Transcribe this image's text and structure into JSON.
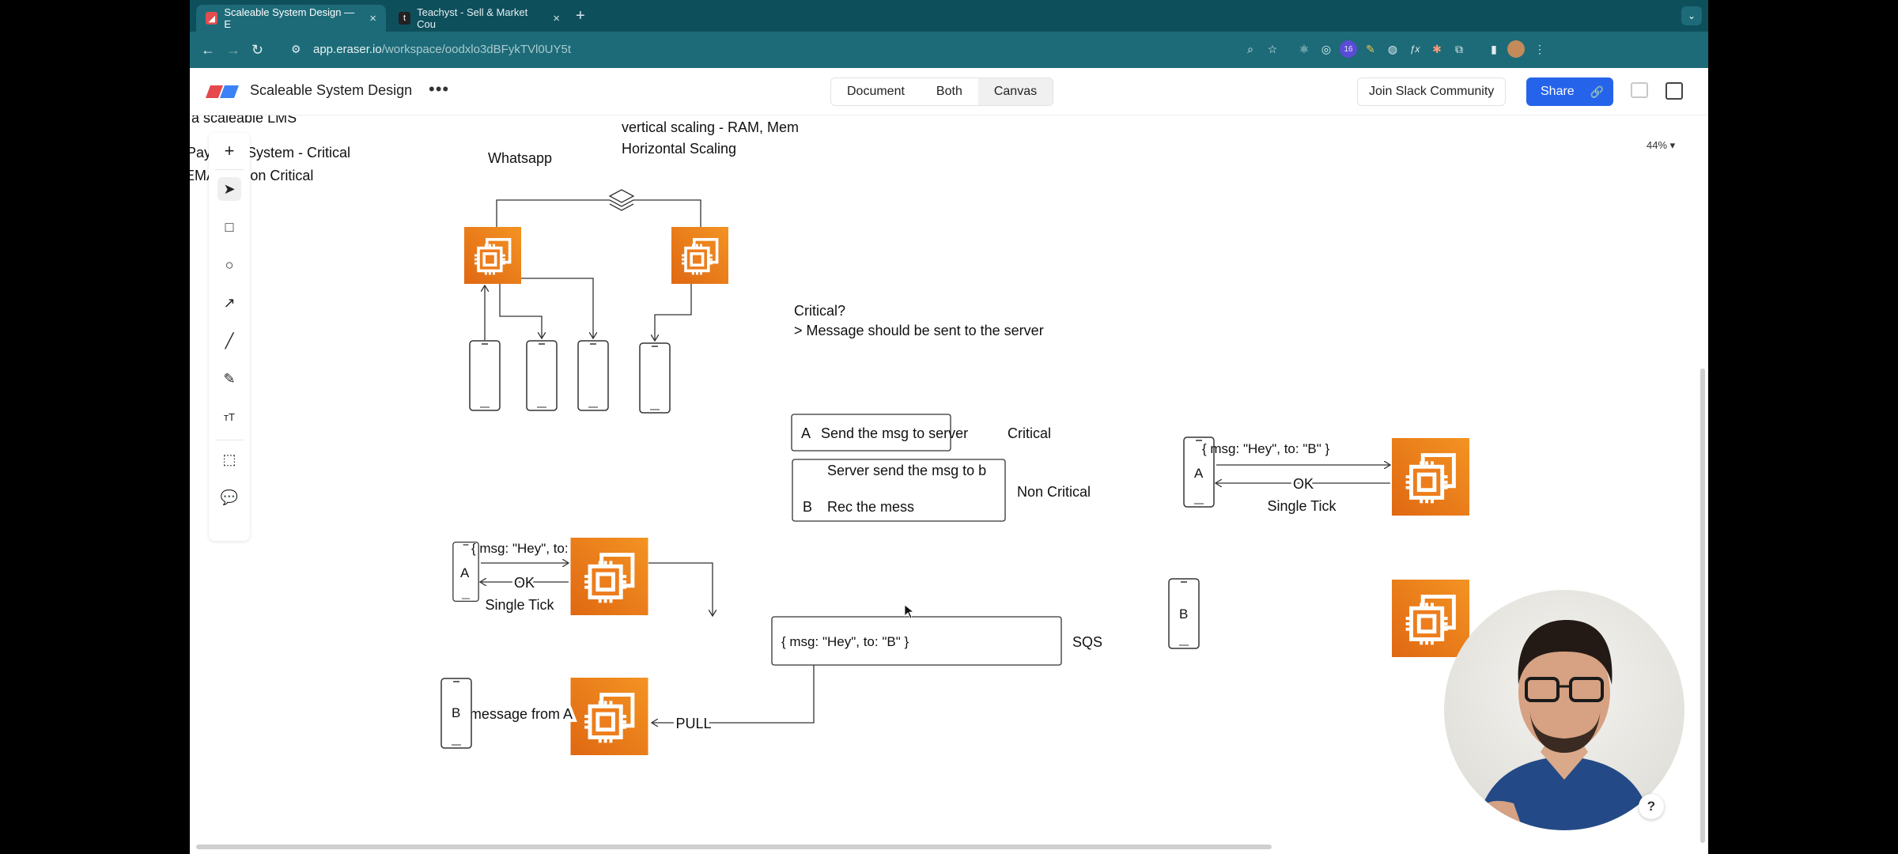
{
  "browser": {
    "tabs": [
      {
        "title": "Scaleable System Design — E",
        "active": true
      },
      {
        "title": "Teachyst - Sell & Market Cou",
        "active": false
      }
    ],
    "url_host": "app.eraser.io",
    "url_path": "/workspace/oodxlo3dBFykTVl0UY5t",
    "extension_badge": "16"
  },
  "app": {
    "title": "Scaleable System Design",
    "more_label": "•••",
    "view_modes": [
      "Document",
      "Both",
      "Canvas"
    ],
    "selected_view": "Canvas",
    "slack_label": "Join Slack Community",
    "share_label": "Share",
    "zoom": "44%"
  },
  "canvas_text": {
    "lms": "a scaleable LMS",
    "payment": "Payment System - Critical",
    "email": "EMAIL - Non Critical",
    "whatsapp": "Whatsapp",
    "vertical": "vertical scaling - RAM, Mem",
    "horizontal": "Horizontal Scaling",
    "critical_q": "Critical?",
    "critical_a": "> Message should be sent to the server",
    "step_a_letter": "A",
    "step_a": "Send the msg to server",
    "critical_label": "Critical",
    "step_server": "Server send the msg to b",
    "step_b_letter": "B",
    "step_b": "Rec the mess",
    "noncritical_label": "Non Critical",
    "msg_payload": "{ msg: \"Hey\", to: \"B\" }",
    "ok": "OK",
    "single_tick": "Single Tick",
    "phone_a": "A",
    "phone_b": "B",
    "queue_payload": "{ msg: \"Hey\", to: \"B\" }",
    "sqs": "SQS",
    "pull": "PULL",
    "message_from_a": "A message from A"
  },
  "help_label": "?"
}
